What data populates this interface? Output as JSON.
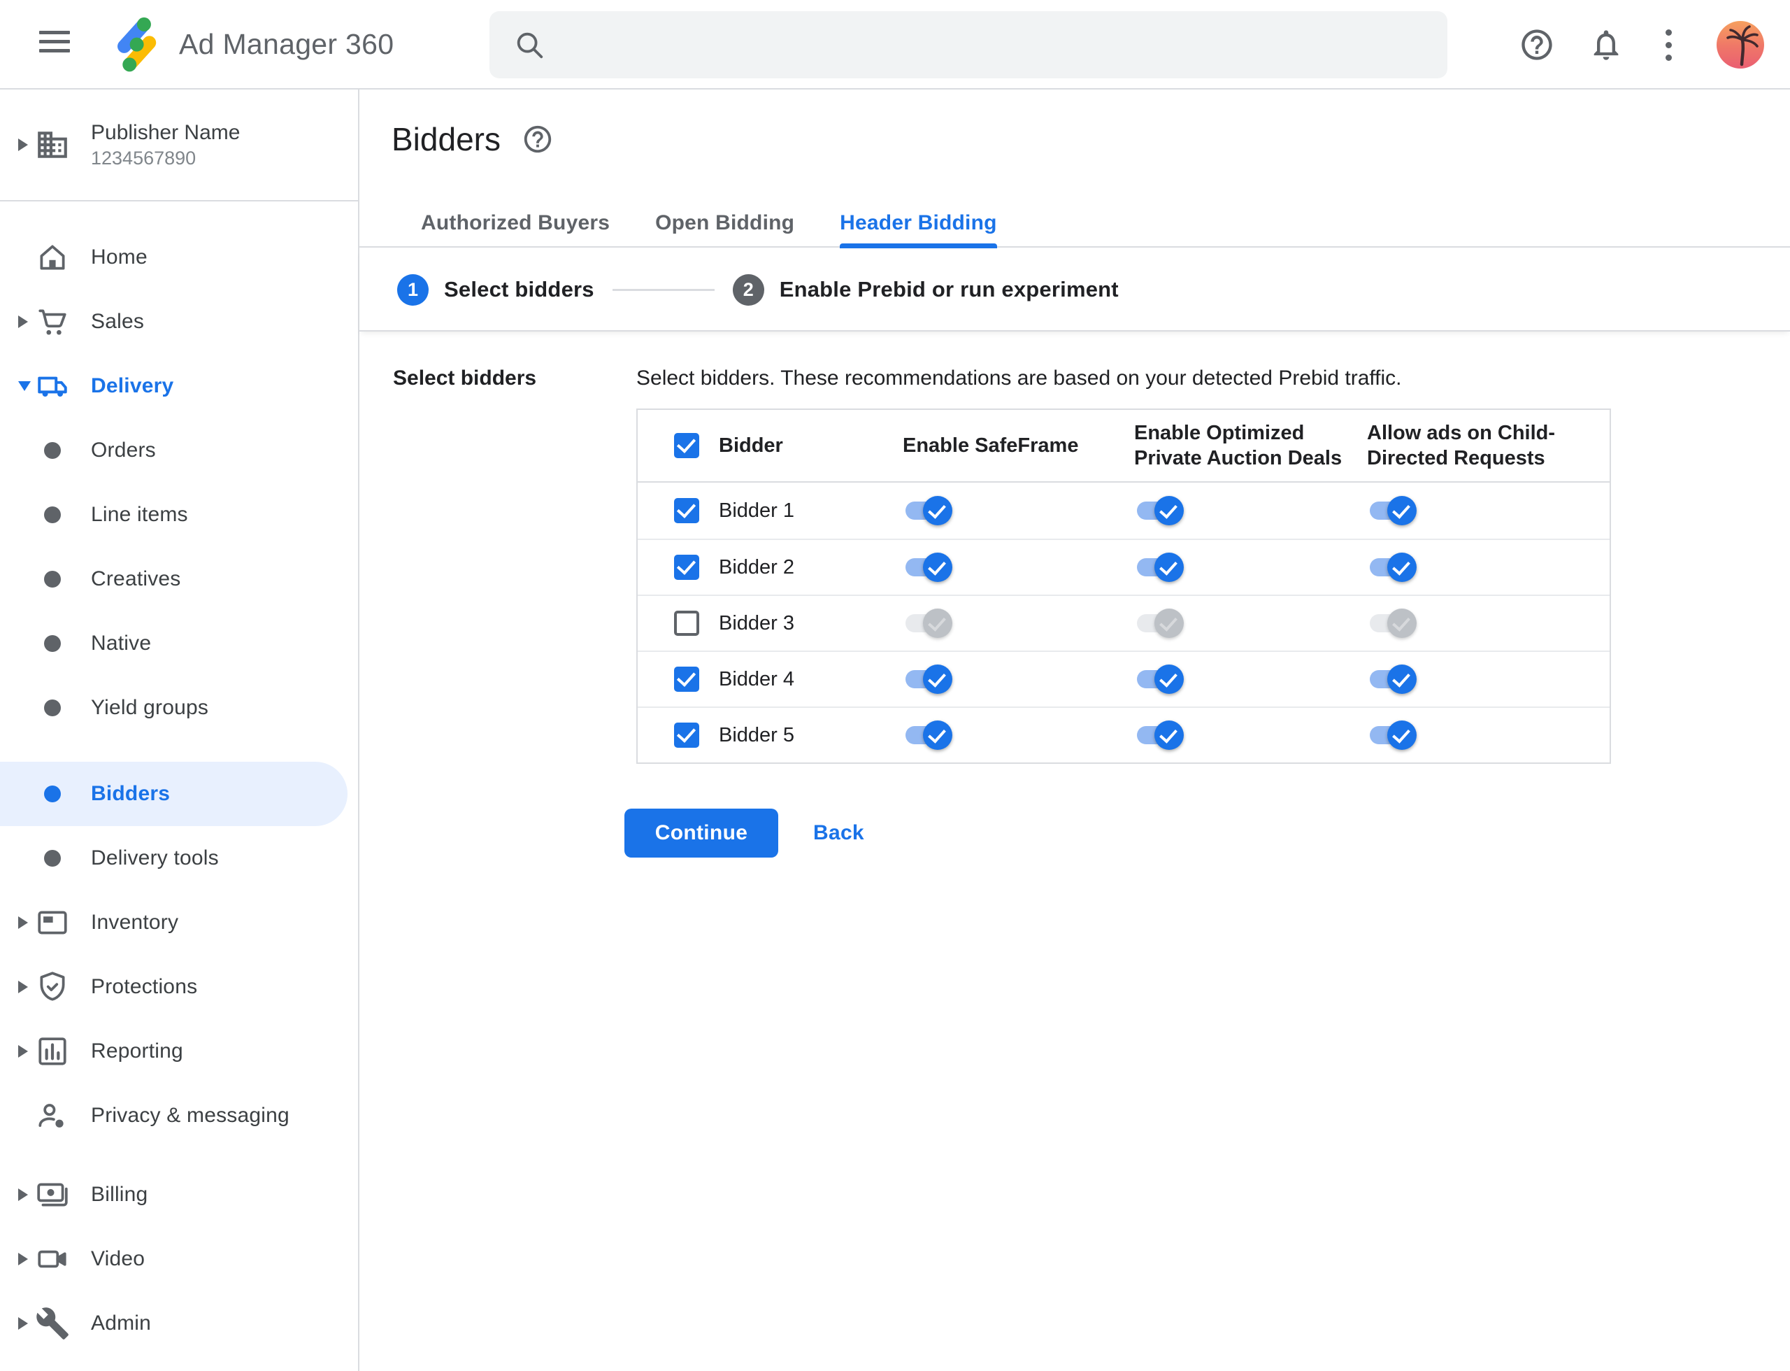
{
  "app": {
    "name": "Ad Manager 360"
  },
  "topbar": {
    "search_value": "",
    "icons": [
      "menu-icon",
      "search-icon",
      "help-icon",
      "notifications-icon",
      "more-options-icon",
      "account-avatar"
    ]
  },
  "sidebar": {
    "publisher": {
      "name": "Publisher Name",
      "id": "1234567890"
    },
    "items": [
      {
        "label": "Home"
      },
      {
        "label": "Sales"
      },
      {
        "label": "Delivery",
        "expanded": true,
        "active": true
      },
      {
        "label": "Orders"
      },
      {
        "label": "Line items"
      },
      {
        "label": "Creatives"
      },
      {
        "label": "Native"
      },
      {
        "label": "Yield groups"
      },
      {
        "label": "Bidders",
        "selected": true
      },
      {
        "label": "Delivery tools"
      },
      {
        "label": "Inventory"
      },
      {
        "label": "Protections"
      },
      {
        "label": "Reporting"
      },
      {
        "label": "Privacy & messaging"
      },
      {
        "label": "Billing"
      },
      {
        "label": "Video"
      },
      {
        "label": "Admin"
      }
    ]
  },
  "page": {
    "title": "Bidders",
    "tabs": [
      {
        "label": "Authorized Buyers",
        "active": false
      },
      {
        "label": "Open Bidding",
        "active": false
      },
      {
        "label": "Header Bidding",
        "active": true
      }
    ],
    "active_tab": "Header Bidding",
    "stepper": [
      {
        "number": "1",
        "label": "Select bidders",
        "state": "active"
      },
      {
        "number": "2",
        "label": "Enable Prebid or run experiment",
        "state": "upcoming"
      }
    ]
  },
  "content": {
    "section_label": "Select bidders",
    "description": "Select bidders. These recommendations are based on your detected Prebid traffic.",
    "table": {
      "header_checkbox": true,
      "columns": [
        "Bidder",
        "Enable SafeFrame",
        "Enable Optimized Private Auction Deals",
        "Allow ads on Child-Directed Requests"
      ],
      "rows": [
        {
          "name": "Bidder 1",
          "selected": true,
          "safeframe": true,
          "optimized": true,
          "child_directed": true
        },
        {
          "name": "Bidder 2",
          "selected": true,
          "safeframe": true,
          "optimized": true,
          "child_directed": true
        },
        {
          "name": "Bidder 3",
          "selected": false,
          "safeframe": false,
          "optimized": false,
          "child_directed": false
        },
        {
          "name": "Bidder 4",
          "selected": true,
          "safeframe": true,
          "optimized": true,
          "child_directed": true
        },
        {
          "name": "Bidder 5",
          "selected": true,
          "safeframe": true,
          "optimized": true,
          "child_directed": true
        }
      ]
    },
    "actions": {
      "continue_label": "Continue",
      "back_label": "Back"
    }
  },
  "colors": {
    "accent": "#1a73e8",
    "accent_track": "#93b8f2",
    "selected_item_bg": "#e8f0fe",
    "text_primary": "#202124",
    "text_secondary": "#5f6368",
    "border": "#dadce0",
    "disabled_thumb": "#bdc1c6",
    "disabled_track": "#e8eaed",
    "search_bg": "#f1f3f4"
  }
}
